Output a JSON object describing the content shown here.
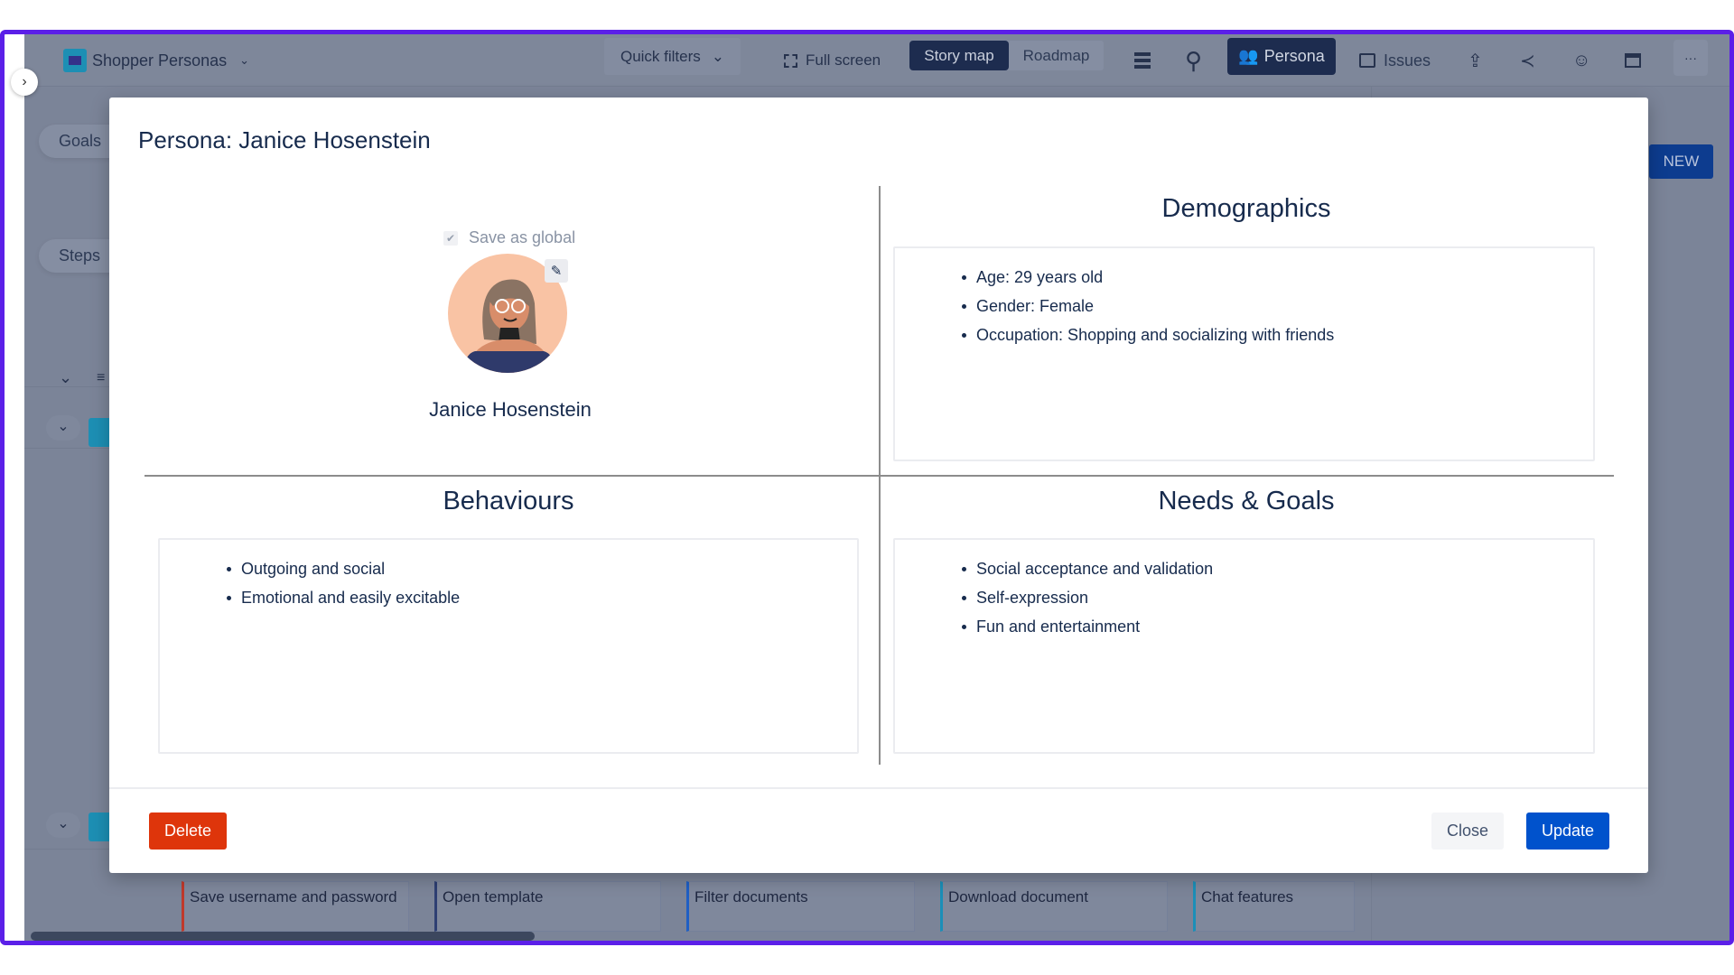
{
  "topbar": {
    "project": "Shopper Personas",
    "quick_filters": "Quick filters",
    "full_screen": "Full screen",
    "story_map": "Story map",
    "roadmap": "Roadmap",
    "persona": "Persona",
    "issues": "Issues",
    "more": "···"
  },
  "sidebar": {
    "goals": "Goals",
    "steps": "Steps"
  },
  "new_button": "NEW",
  "cards": [
    "Save username and password",
    "Open template",
    "Filter documents",
    "Download document",
    "Chat features"
  ],
  "card_colors": [
    "#c0392b",
    "#2e3f73",
    "#1f5fc4",
    "#1b8fb8",
    "#1b8fb8"
  ],
  "modal": {
    "title": "Persona: Janice Hosenstein",
    "save_as_global": "Save as global",
    "save_as_global_checked": true,
    "name": "Janice Hosenstein",
    "demographics": {
      "title": "Demographics",
      "items": [
        "Age: 29 years old",
        "Gender: Female",
        "Occupation: Shopping and socializing with friends"
      ]
    },
    "behaviours": {
      "title": "Behaviours",
      "items": [
        "Outgoing and social",
        "Emotional and easily excitable"
      ]
    },
    "needs": {
      "title": "Needs & Goals",
      "items": [
        "Social acceptance and validation",
        "Self-expression",
        "Fun and entertainment"
      ]
    },
    "delete": "Delete",
    "close": "Close",
    "update": "Update"
  },
  "colors": {
    "accent": "#5b1fe8",
    "delete": "#de350b",
    "primary": "#0052cc"
  }
}
